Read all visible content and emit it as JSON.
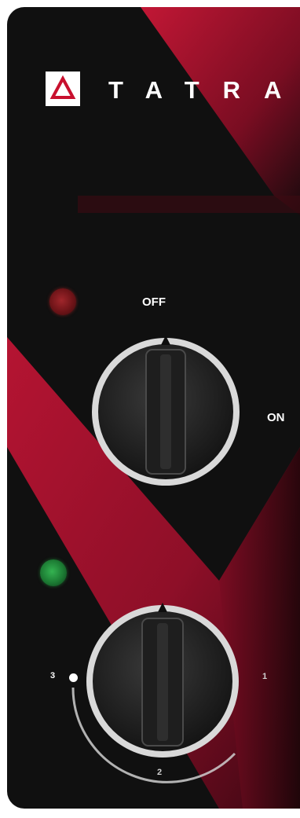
{
  "brand": {
    "name": "TATRA",
    "logo_icon": "triangle-logo-icon",
    "accent": "#c8102e"
  },
  "panel": {
    "background": "#101010",
    "stripe_color": "#9b0f2a"
  },
  "power_switch": {
    "label_off": "OFF",
    "label_on": "ON",
    "indicator": "red-indicator-lamp",
    "indicator_color": "#8a1a1e"
  },
  "heat_selector": {
    "indicator": "green-indicator-lamp",
    "indicator_color": "#2a9a45",
    "positions": [
      "1",
      "2",
      "3"
    ]
  }
}
